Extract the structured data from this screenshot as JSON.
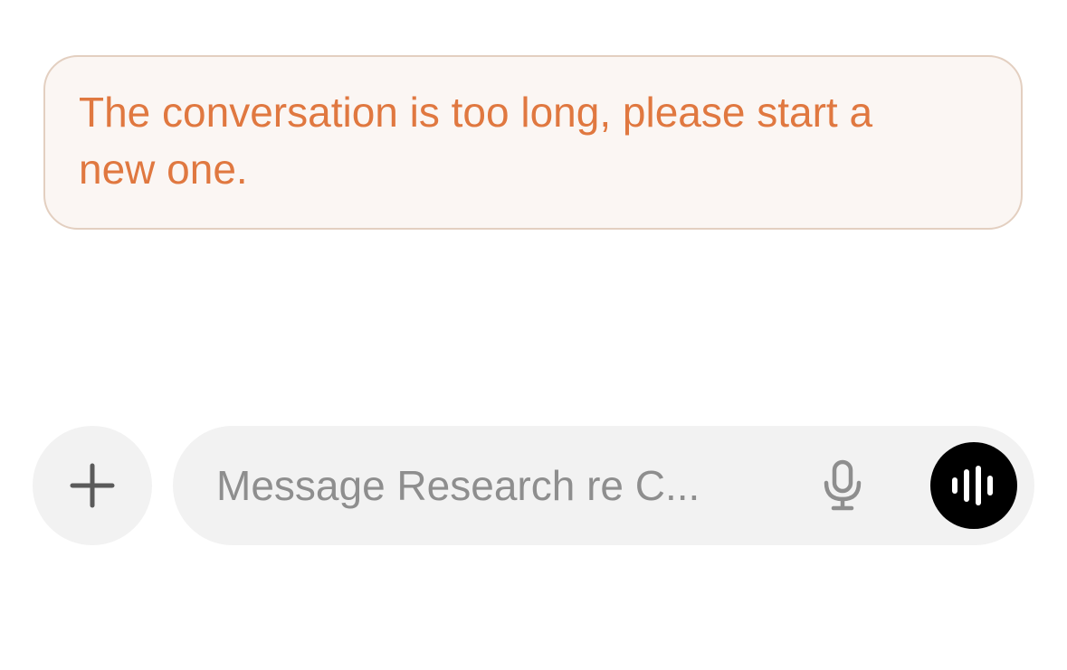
{
  "notice": {
    "message": "The conversation is too long, please start a new one."
  },
  "composer": {
    "placeholder": "Message Research re C..."
  },
  "icons": {
    "add": "plus-icon",
    "dictation": "microphone-icon",
    "voice_mode": "waveform-icon"
  },
  "colors": {
    "notice_text": "#e07840",
    "notice_background": "#fbf6f3",
    "notice_border": "#e3cfc0",
    "control_background": "#f2f2f2",
    "placeholder": "#8e8e8e",
    "voice_button": "#000000"
  }
}
